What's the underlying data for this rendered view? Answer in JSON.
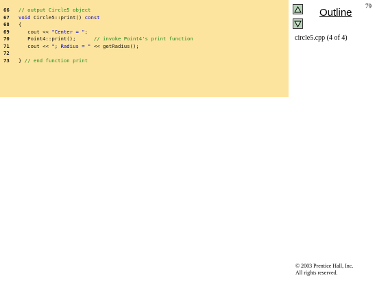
{
  "code": {
    "lines": [
      {
        "num": "66",
        "tokens": [
          {
            "t": "// output Circle5 object",
            "c": "comment"
          }
        ]
      },
      {
        "num": "67",
        "tokens": [
          {
            "t": "void ",
            "c": "kw"
          },
          {
            "t": "Circle5::print() ",
            "c": "plain"
          },
          {
            "t": "const",
            "c": "kw"
          }
        ]
      },
      {
        "num": "68",
        "tokens": [
          {
            "t": "{",
            "c": "plain"
          }
        ]
      },
      {
        "num": "69",
        "tokens": [
          {
            "t": "   cout << ",
            "c": "plain"
          },
          {
            "t": "\"Center = \"",
            "c": "str"
          },
          {
            "t": ";",
            "c": "plain"
          }
        ]
      },
      {
        "num": "70",
        "tokens": [
          {
            "t": "   Point4::print();      ",
            "c": "plain"
          },
          {
            "t": "// invoke Point4's print function",
            "c": "comment"
          }
        ]
      },
      {
        "num": "71",
        "tokens": [
          {
            "t": "   cout << ",
            "c": "plain"
          },
          {
            "t": "\"; Radius = \"",
            "c": "str"
          },
          {
            "t": " << getRadius();",
            "c": "plain"
          }
        ]
      },
      {
        "num": "72",
        "tokens": []
      },
      {
        "num": "73",
        "tokens": [
          {
            "t": "} ",
            "c": "plain"
          },
          {
            "t": "// end function print",
            "c": "comment"
          }
        ]
      }
    ]
  },
  "sidebar": {
    "up_icon": "triangle-up-icon",
    "down_icon": "triangle-down-icon",
    "outline_label": "Outline",
    "file_label": "circle5.cpp (4 of 4)"
  },
  "page_number": "79",
  "footer": {
    "copyright_line1": "© 2003 Prentice Hall, Inc.",
    "copyright_line2": "All rights reserved."
  },
  "colors": {
    "code_background": "#fde49e",
    "comment": "#1e8a1e",
    "keyword": "#0000cc",
    "nav_button": "#b8d3b8"
  }
}
